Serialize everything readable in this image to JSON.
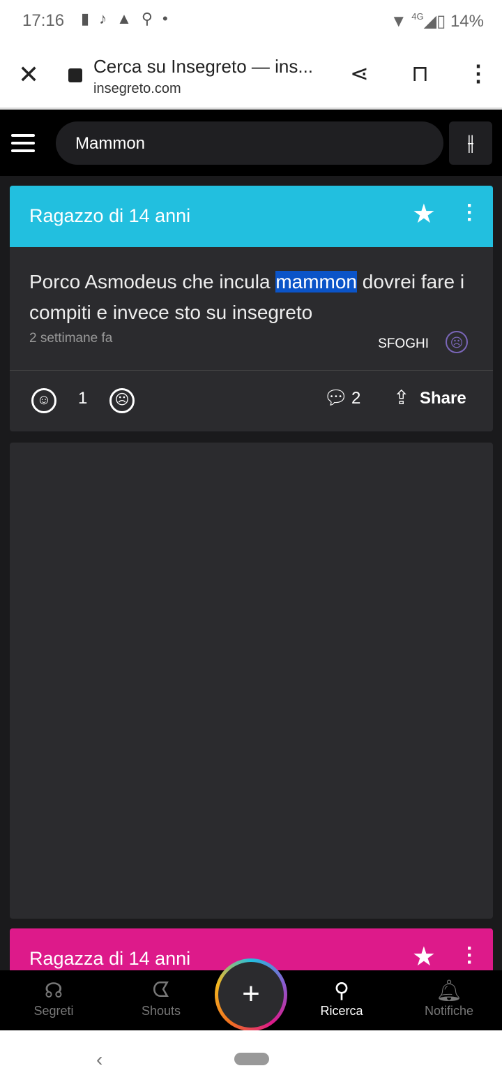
{
  "status": {
    "time": "17:16",
    "network": "4G",
    "battery": "14%"
  },
  "browser": {
    "title": "Cerca su Insegreto — ins...",
    "domain": "insegreto.com"
  },
  "search": {
    "value": "Mammon"
  },
  "posts": [
    {
      "author": "Ragazzo di 14 anni",
      "color": "#22bfdf",
      "text_before": "Porco Asmodeus che incula ",
      "highlight": "mammon",
      "text_after": " dovrei fare i compiti e invece sto su insegreto",
      "time": "2 settimane fa",
      "category": "SFOGHI",
      "likes": "1",
      "comments": "2",
      "share": "Share"
    },
    {
      "author": "Ragazza di 14 anni",
      "color": "#dd1a8a"
    }
  ],
  "nav": {
    "items": [
      {
        "label": "Segreti"
      },
      {
        "label": "Shouts"
      },
      {
        "label": "Ricerca"
      },
      {
        "label": "Notifiche"
      }
    ],
    "add": "+"
  }
}
